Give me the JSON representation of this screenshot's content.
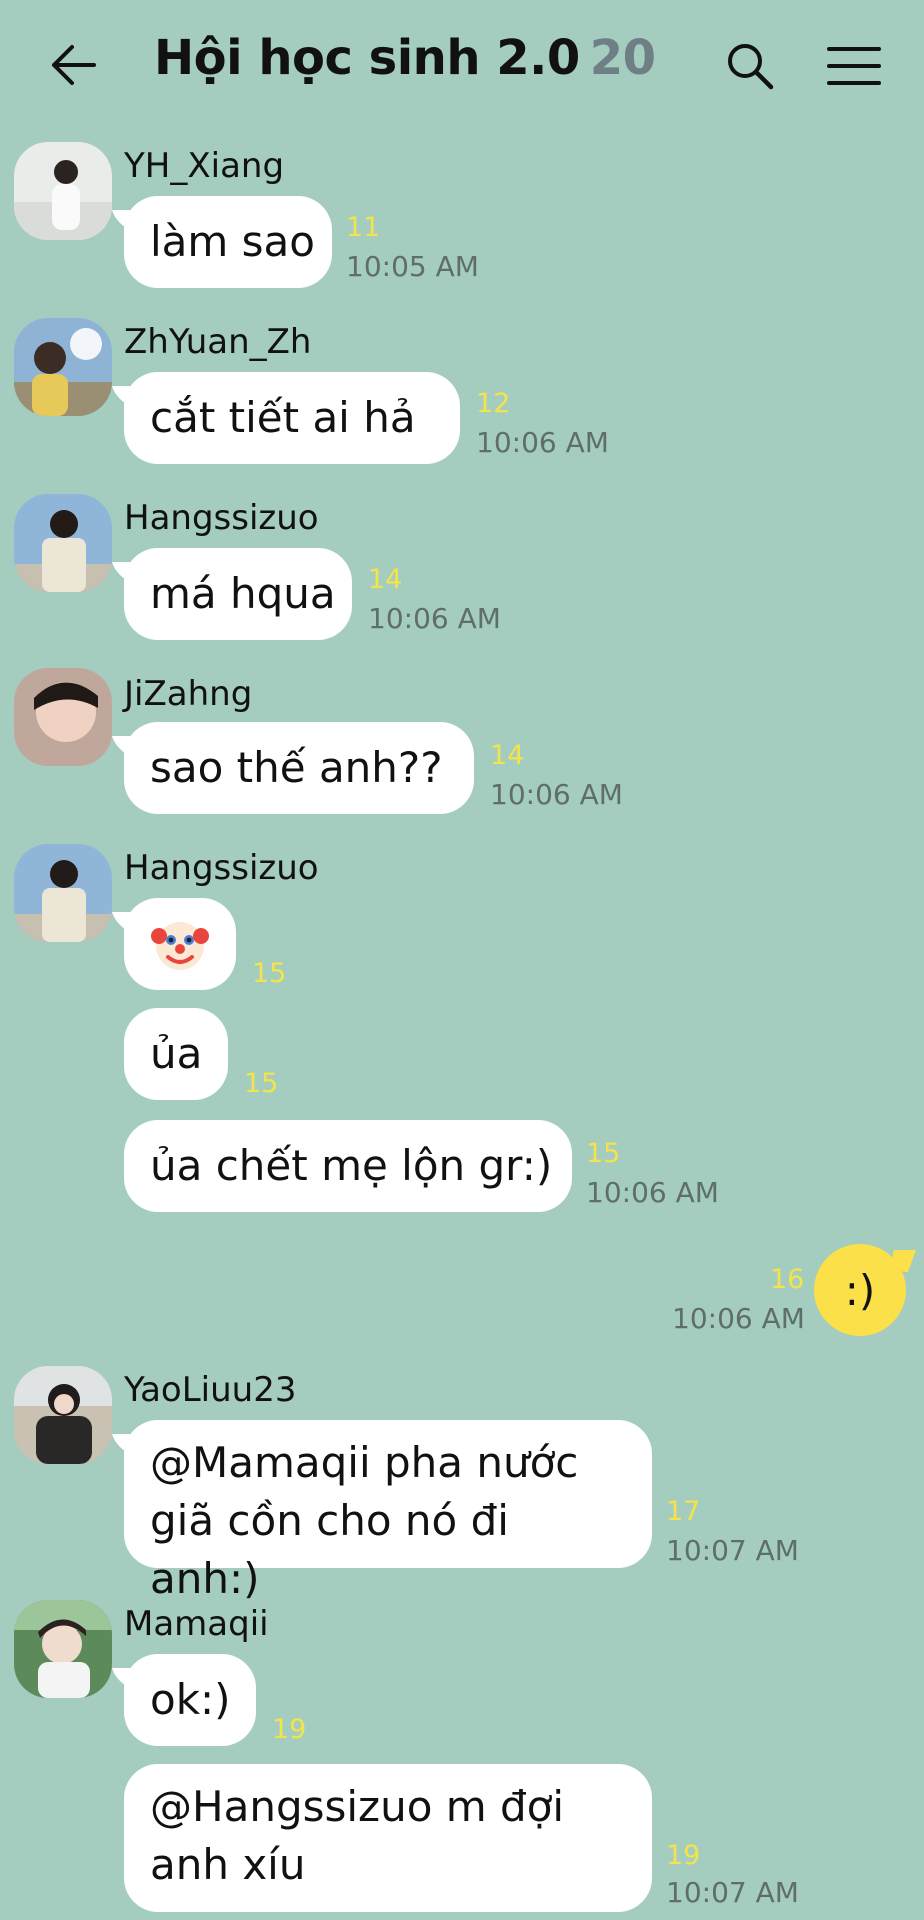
{
  "header": {
    "title": "Hội học sinh 2.0",
    "member_count": "20",
    "back_icon": "arrow-left-icon",
    "search_icon": "search-icon",
    "menu_icon": "hamburger-menu-icon"
  },
  "messages": [
    {
      "sender": "YH_Xiang",
      "text": "làm sao",
      "read": "11",
      "time": "10:05 AM"
    },
    {
      "sender": "ZhYuan_Zh",
      "text": "cắt tiết ai hả",
      "read": "12",
      "time": "10:06 AM"
    },
    {
      "sender": "Hangssizuo",
      "text": "má hqua",
      "read": "14",
      "time": "10:06 AM"
    },
    {
      "sender": "JiZahng",
      "text": "sao thế anh??",
      "read": "14",
      "time": "10:06 AM"
    },
    {
      "sender": "Hangssizuo",
      "emoji": "clown-face-emoji",
      "read": "15"
    },
    {
      "text": "ủa",
      "read": "15"
    },
    {
      "text": "ủa chết mẹ lộn gr:)",
      "read": "15",
      "time": "10:06 AM"
    },
    {
      "mine": true,
      "text": ":)",
      "read": "16",
      "time": "10:06 AM"
    },
    {
      "sender": "YaoLiuu23",
      "line1": "@Mamaqii pha nước",
      "line2": "giã cồn cho nó đi anh:)",
      "read": "17",
      "time": "10:07 AM"
    },
    {
      "sender": "Mamaqii",
      "text": "ok:)",
      "read": "19"
    },
    {
      "line1": "@Hangssizuo m đợi",
      "line2": "anh xíu",
      "read": "19",
      "time": "10:07 AM"
    }
  ],
  "colors": {
    "background": "#a4cdbf",
    "bubble": "#ffffff",
    "my_bubble": "#fbe04a",
    "read_count": "#f4e34a",
    "time": "#5f6e6b"
  }
}
